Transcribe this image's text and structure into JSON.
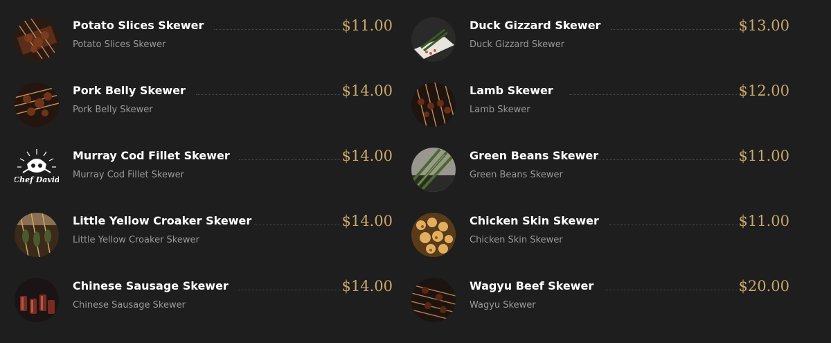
{
  "menu": {
    "left": [
      {
        "name": "Potato Slices Skewer",
        "description": "Potato Slices Skewer",
        "price": "$11.00",
        "image": "grilled-skewers-photo"
      },
      {
        "name": "Pork Belly Skewer",
        "description": "Pork Belly Skewer",
        "price": "$14.00",
        "image": "grilled-skewers-photo"
      },
      {
        "name": "Murray Cod Fillet Skewer",
        "description": "Murray Cod Fillet Skewer",
        "price": "$14.00",
        "image": "chef-david-logo",
        "logo_text": "Chef David"
      },
      {
        "name": "Little Yellow Croaker Skewer",
        "description": "Little Yellow Croaker Skewer",
        "price": "$14.00",
        "image": "grilled-fish-skewers-photo"
      },
      {
        "name": "Chinese Sausage Skewer",
        "description": "Chinese Sausage Skewer",
        "price": "$14.00",
        "image": "sausage-skewers-photo"
      }
    ],
    "right": [
      {
        "name": "Duck Gizzard Skewer",
        "description": "Duck Gizzard Skewer",
        "price": "$13.00",
        "image": "plated-skewers-photo"
      },
      {
        "name": "Lamb Skewer",
        "description": "Lamb Skewer",
        "price": "$12.00",
        "image": "grilled-skewers-photo"
      },
      {
        "name": "Green Beans Skewer",
        "description": "Green Beans Skewer",
        "price": "$11.00",
        "image": "green-beans-skewers-photo"
      },
      {
        "name": "Chicken Skin Skewer",
        "description": "Chicken Skin Skewer",
        "price": "$11.00",
        "image": "chicken-skin-skewers-photo"
      },
      {
        "name": "Wagyu Beef Skewer",
        "description": "Wagyu Skewer",
        "price": "$20.00",
        "image": "grilled-skewers-photo"
      }
    ]
  },
  "colors": {
    "background": "#1e1e1e",
    "item_name": "#ffffff",
    "item_description": "#9a9a9a",
    "price": "#c9a86a"
  }
}
